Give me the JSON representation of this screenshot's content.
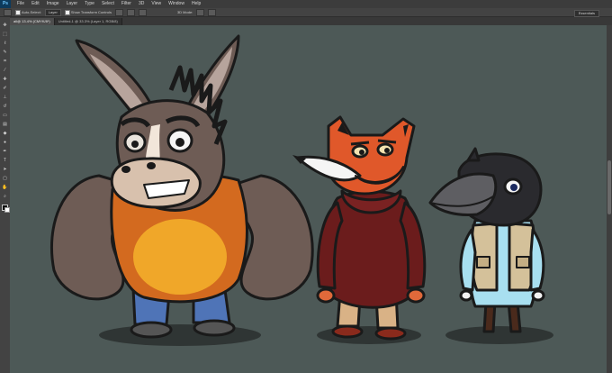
{
  "menubar": {
    "logo": "Ps",
    "items": [
      "File",
      "Edit",
      "Image",
      "Layer",
      "Type",
      "Select",
      "Filter",
      "3D",
      "View",
      "Window",
      "Help"
    ]
  },
  "options": {
    "auto_select_label": "Auto-Select:",
    "auto_select_value": "Layer",
    "transform_label": "Show Transform Controls",
    "mode_3d": "3D Mode:",
    "workspace": "Essentials"
  },
  "tabs": [
    {
      "label": "all@ 13.4% (CMYK/8*)"
    },
    {
      "label": "Untitled-1 @ 33.3% (Layer 1, RGB/8)"
    }
  ],
  "tools": [
    "move",
    "marquee",
    "lasso",
    "quick-select",
    "crop",
    "eyedropper",
    "heal",
    "brush",
    "stamp",
    "history",
    "eraser",
    "gradient",
    "blur",
    "dodge",
    "pen",
    "type",
    "path-select",
    "shape",
    "hand",
    "zoom"
  ],
  "colors": {
    "canvas_bg": "#4d5957",
    "ui_dark": "#3c3c3c",
    "ui_mid": "#434343"
  },
  "characters": [
    {
      "name": "donkey",
      "description_icon": "donkey-character"
    },
    {
      "name": "fox",
      "description_icon": "fox-character"
    },
    {
      "name": "crow",
      "description_icon": "crow-character"
    }
  ]
}
